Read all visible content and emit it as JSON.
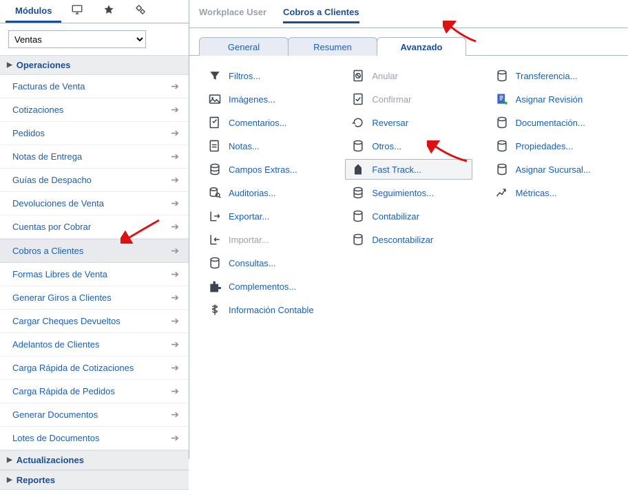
{
  "sidebar": {
    "tabs": [
      {
        "name": "modules",
        "label": "Módulos"
      },
      {
        "name": "monitor",
        "label": ""
      },
      {
        "name": "favorites",
        "label": ""
      },
      {
        "name": "addons",
        "label": ""
      }
    ],
    "module_select": {
      "value": "Ventas"
    },
    "sections": {
      "operaciones": {
        "label": "Operaciones"
      },
      "actualizaciones": {
        "label": "Actualizaciones"
      },
      "reportes": {
        "label": "Reportes"
      }
    },
    "items": [
      {
        "label": "Facturas de Venta",
        "selected": false
      },
      {
        "label": "Cotizaciones",
        "selected": false
      },
      {
        "label": "Pedidos",
        "selected": false
      },
      {
        "label": "Notas de Entrega",
        "selected": false
      },
      {
        "label": "Guías de Despacho",
        "selected": false
      },
      {
        "label": "Devoluciones de Venta",
        "selected": false
      },
      {
        "label": "Cuentas por Cobrar",
        "selected": false
      },
      {
        "label": "Cobros a Clientes",
        "selected": true
      },
      {
        "label": "Formas Libres de Venta",
        "selected": false
      },
      {
        "label": "Generar Giros a Clientes",
        "selected": false
      },
      {
        "label": "Cargar Cheques Devueltos",
        "selected": false
      },
      {
        "label": "Adelantos de Clientes",
        "selected": false
      },
      {
        "label": "Carga Rápida de Cotizaciones",
        "selected": false
      },
      {
        "label": "Carga Rápida de Pedidos",
        "selected": false
      },
      {
        "label": "Generar Documentos",
        "selected": false
      },
      {
        "label": "Lotes de Documentos",
        "selected": false
      }
    ]
  },
  "breadcrumb": [
    {
      "label": "Workplace User",
      "active": false
    },
    {
      "label": "Cobros a Clientes",
      "active": true
    }
  ],
  "subtabs": [
    {
      "label": "General",
      "active": false
    },
    {
      "label": "Resumen",
      "active": false
    },
    {
      "label": "Avanzado",
      "active": true
    }
  ],
  "actions": {
    "col1": [
      {
        "icon": "filter-icon",
        "label": "Filtros...",
        "state": "normal"
      },
      {
        "icon": "image-icon",
        "label": "Imágenes...",
        "state": "normal"
      },
      {
        "icon": "comments-icon",
        "label": "Comentarios...",
        "state": "normal"
      },
      {
        "icon": "notes-icon",
        "label": "Notas...",
        "state": "normal"
      },
      {
        "icon": "extra-fields-icon",
        "label": "Campos Extras...",
        "state": "normal"
      },
      {
        "icon": "audit-icon",
        "label": "Auditorias...",
        "state": "normal"
      },
      {
        "icon": "export-icon",
        "label": "Exportar...",
        "state": "normal"
      },
      {
        "icon": "import-icon",
        "label": "Importar...",
        "state": "disabled"
      },
      {
        "icon": "queries-icon",
        "label": "Consultas...",
        "state": "normal"
      },
      {
        "icon": "complements-icon",
        "label": "Complementos...",
        "state": "normal"
      },
      {
        "icon": "accounting-info-icon",
        "label": "Información Contable",
        "state": "normal"
      }
    ],
    "col2": [
      {
        "icon": "void-icon",
        "label": "Anular",
        "state": "disabled"
      },
      {
        "icon": "confirm-icon",
        "label": "Confirmar",
        "state": "disabled"
      },
      {
        "icon": "reverse-icon",
        "label": "Reversar",
        "state": "normal"
      },
      {
        "icon": "others-icon",
        "label": "Otros...",
        "state": "normal"
      },
      {
        "icon": "fast-track-icon",
        "label": "Fast Track...",
        "state": "boxed"
      },
      {
        "icon": "followups-icon",
        "label": "Seguimientos...",
        "state": "normal"
      },
      {
        "icon": "post-icon",
        "label": "Contabilizar",
        "state": "normal"
      },
      {
        "icon": "unpost-icon",
        "label": "Descontabilizar",
        "state": "normal"
      }
    ],
    "col3": [
      {
        "icon": "transfer-icon",
        "label": "Transferencia...",
        "state": "normal"
      },
      {
        "icon": "assign-revision-icon",
        "label": "Asignar Revisión",
        "state": "normal"
      },
      {
        "icon": "documentation-icon",
        "label": "Documentación...",
        "state": "normal"
      },
      {
        "icon": "properties-icon",
        "label": "Propiedades...",
        "state": "normal"
      },
      {
        "icon": "assign-branch-icon",
        "label": "Asignar Sucursal...",
        "state": "normal"
      },
      {
        "icon": "metrics-icon",
        "label": "Métricas...",
        "state": "normal"
      }
    ]
  }
}
